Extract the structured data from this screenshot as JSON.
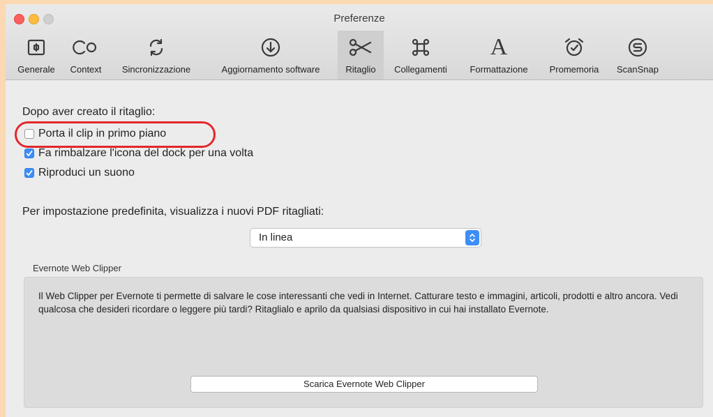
{
  "window": {
    "title": "Preferenze"
  },
  "toolbar": {
    "items": [
      {
        "label": "Generale",
        "icon": "generale-icon"
      },
      {
        "label": "Context",
        "icon": "context-icon"
      },
      {
        "label": "Sincronizzazione",
        "icon": "sync-icon"
      },
      {
        "label": "Aggiornamento software",
        "icon": "download-icon"
      },
      {
        "label": "Ritaglio",
        "icon": "scissors-icon",
        "active": true
      },
      {
        "label": "Collegamenti",
        "icon": "command-icon"
      },
      {
        "label": "Formattazione",
        "icon": "font-icon"
      },
      {
        "label": "Promemoria",
        "icon": "alarm-clock-icon"
      },
      {
        "label": "ScanSnap",
        "icon": "scansnap-icon"
      }
    ]
  },
  "clip": {
    "heading": "Dopo aver creato il ritaglio:",
    "options": [
      {
        "label": "Porta il clip in primo piano",
        "checked": false,
        "highlighted": true
      },
      {
        "label": "Fa rimbalzare l'icona del dock per una volta",
        "checked": true
      },
      {
        "label": "Riproduci un suono",
        "checked": true
      }
    ]
  },
  "pdf": {
    "label": "Per impostazione predefinita, visualizza i nuovi PDF ritagliati:",
    "selected": "In linea"
  },
  "web_clipper": {
    "group_label": "Evernote Web Clipper",
    "description": "Il Web Clipper per Evernote ti permette di salvare le cose interessanti che vedi in Internet. Catturare testo e immagini, articoli, prodotti e altro ancora. Vedi qualcosa che desideri ricordare o leggere più tardi? Ritaglialo e aprilo da qualsiasi dispositivo in cui hai installato Evernote.",
    "button": "Scarica Evernote Web Clipper"
  },
  "colors": {
    "background": "#fbd9b3",
    "accent": "#3d8ef6",
    "highlight": "#e3272c"
  }
}
